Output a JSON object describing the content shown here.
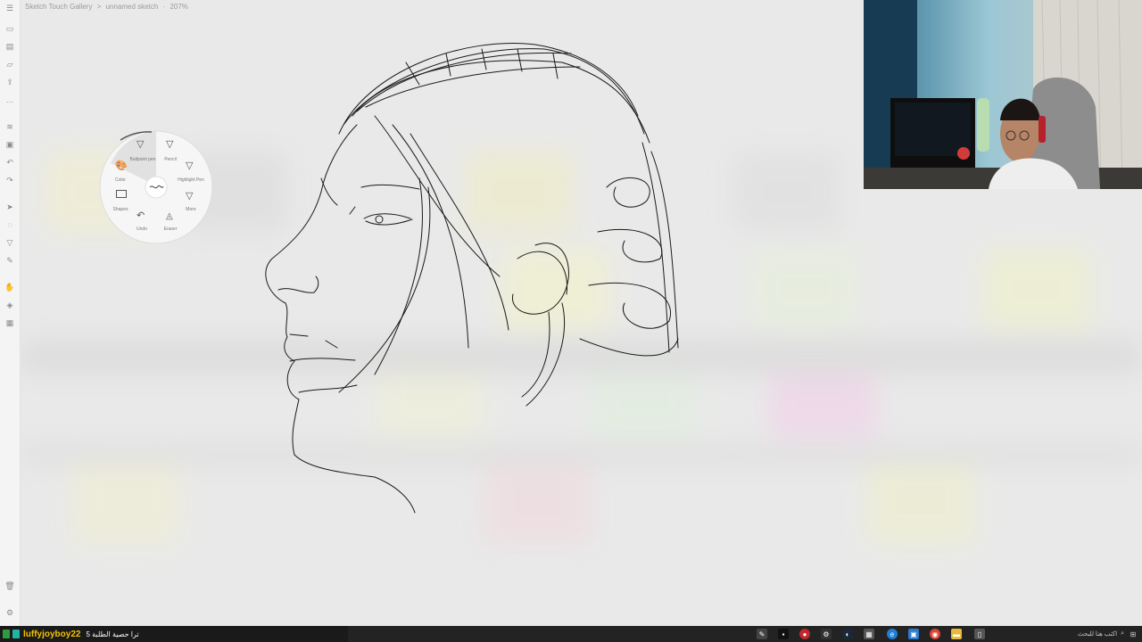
{
  "app": {
    "breadcrumb": [
      "Sketch Touch Gallery",
      ">",
      "unnamed sketch",
      "·",
      "207%"
    ]
  },
  "radial_menu": {
    "tools": [
      {
        "name": "ballpoint-pen",
        "label": "Ballpoint pen",
        "icon": "pen-icon"
      },
      {
        "name": "pencil",
        "label": "Pencil",
        "icon": "pencil-icon"
      },
      {
        "name": "highlight-pen",
        "label": "Highlight Pen",
        "icon": "highlighter-icon"
      },
      {
        "name": "more",
        "label": "More",
        "icon": "more-pen-icon"
      },
      {
        "name": "eraser",
        "label": "Eraser",
        "icon": "eraser-icon"
      },
      {
        "name": "undo",
        "label": "Undo",
        "icon": "undo-icon"
      },
      {
        "name": "shapes",
        "label": "Shapes",
        "icon": "rectangle-icon"
      },
      {
        "name": "color",
        "label": "Color",
        "icon": "palette-icon"
      }
    ]
  },
  "stream_overlay": {
    "ticker_user": "luffyjoyboy22",
    "ticker_message": "ترا حصية الطلبة 5"
  },
  "taskbar": {
    "search_placeholder": "اكتب هنا للبحث",
    "icons": [
      "pen-tool-icon",
      "terminal-icon",
      "record-icon",
      "settings-icon",
      "steam-icon",
      "calculator-icon",
      "edge-icon",
      "store-icon",
      "chrome-icon",
      "folder-icon",
      "tablet-icon"
    ]
  },
  "colors": {
    "taskbar_bg": "#232323",
    "ticker_user": "#f2c200",
    "canvas_bg": "#e9e9e9"
  }
}
